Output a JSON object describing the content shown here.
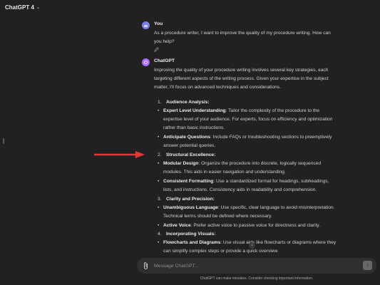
{
  "header": {
    "model": "ChatGPT 4"
  },
  "user_message": {
    "author": "You",
    "text_lines": [
      "As a procedure writer, I want to improve the quality of my procedure writing. How can",
      "you help?"
    ]
  },
  "assistant_message": {
    "author": "ChatGPT",
    "intro_lines": [
      "Improving the quality of your procedure writing involves several key strategies, each",
      "targeting different aspects of the writing process. Given your expertise in the subject",
      "matter, I'll focus on advanced techniques and considerations."
    ],
    "sections": [
      {
        "number": "1.",
        "title": "Audience Analysis:",
        "bullets": [
          {
            "bold": "Expert Level Understanding",
            "lines": [
              ": Tailor the complexity of the procedure to the",
              "expertise level of your audience. For experts, focus on efficiency and optimization",
              "rather than basic instructions."
            ]
          },
          {
            "bold": "Anticipate Questions",
            "lines": [
              ": Include FAQs or troubleshooting sections to preemptively",
              "answer potential queries."
            ]
          }
        ]
      },
      {
        "number": "2.",
        "title": "Structural Excellence:",
        "bullets": [
          {
            "bold": "Modular Design",
            "lines": [
              ": Organize the procedure into discrete, logically sequenced",
              "modules. This aids in easier navigation and understanding."
            ]
          },
          {
            "bold": "Consistent Formatting",
            "lines": [
              ": Use a standardized format for headings, subheadings,",
              "lists, and instructions. Consistency aids in readability and comprehension."
            ]
          }
        ]
      },
      {
        "number": "3.",
        "title": "Clarity and Precision:",
        "bullets": [
          {
            "bold": "Unambiguous Language",
            "lines": [
              ": Use specific, clear language to avoid misinterpretation.",
              "Technical terms should be defined where necessary."
            ]
          },
          {
            "bold": "Active Voice",
            "lines": [
              ": Prefer active voice to passive voice for directness and clarity."
            ]
          }
        ]
      },
      {
        "number": "4.",
        "title": "Incorporating Visuals:",
        "bullets": [
          {
            "bold": "Flowcharts and Diagrams",
            "lines": [
              ": Use visual aids like flowcharts or diagrams where they",
              "can simplify complex steps or provide a quick overview."
            ]
          }
        ]
      }
    ]
  },
  "composer": {
    "placeholder": "Message ChatGPT..."
  },
  "footer": {
    "disclaimer": "ChatGPT can make mistakes. Consider checking important information."
  },
  "colors": {
    "background": "#212121",
    "annotation_arrow": "#e03a36",
    "user_avatar": "#7b7fe8",
    "gpt_avatar": "#ab68ff"
  },
  "icons": [
    "chevron-down-icon",
    "user-avatar-icon",
    "chatgpt-avatar-icon",
    "edit-icon",
    "attach-icon",
    "send-icon",
    "arrow-down-icon",
    "red-arrow-annotation"
  ]
}
